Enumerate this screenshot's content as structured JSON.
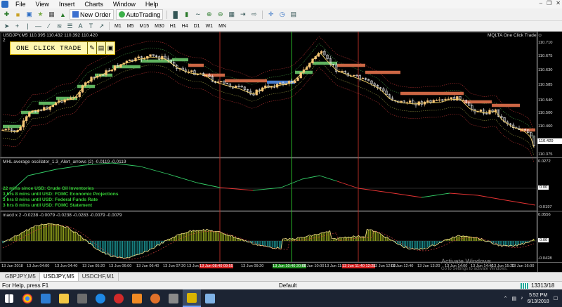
{
  "menu": [
    "File",
    "View",
    "Insert",
    "Charts",
    "Window",
    "Help"
  ],
  "toolbar": {
    "new_order": "New Order",
    "autotrading": "AutoTrading",
    "timeframes": [
      "M1",
      "M5",
      "M15",
      "M30",
      "H1",
      "H4",
      "D1",
      "W1",
      "MN"
    ]
  },
  "chart": {
    "symbol_line": "USDJPY,M5  110.395 110.432 110.392 110.420",
    "sub_line": "2",
    "panel_title": "MQLTA One Click Trade",
    "oct_label": "ONE CLICK TRADE",
    "oct_buttons": [
      "pencil-icon",
      "book-icon",
      "document-icon"
    ],
    "price_ticks": [
      "110.710",
      "110.675",
      "110.630",
      "110.585",
      "110.540",
      "110.500",
      "110.460",
      "110.375"
    ],
    "current_price": "110.420",
    "osc_title": "MHL average oscillator_1.3_Alert_arrows (2) -0.0119 -0.0119",
    "osc_ticks": [
      "0.0272",
      "0.00",
      "-0.0197"
    ],
    "macd_title": "macd x 2 -0.0238 -0.0079 -0.0238 -0.0283 -0.0079 -0.0079",
    "macd_ticks": [
      "0.0556",
      "0.00",
      "-0.0428"
    ],
    "news": [
      "22 mins since USD: Crude Oil Inventories",
      "3 hrs 8 mins until USD: FOMC Economic Projections",
      "3 hrs 8 mins until USD: Federal Funds Rate",
      "3 hrs 8 mins until USD: FOMC Statement"
    ],
    "time_labels": [
      "13 Jun 2018",
      "13 Jun 04:00",
      "13 Jun 04:40",
      "13 Jun 05:20",
      "13 Jun 06:00",
      "13 Jun 06:40",
      "13 Jun 07:20",
      "13 Jun 08:00",
      "13 Jun 09:20",
      "13 Jun 10:00",
      "13 Jun 11:20",
      "13 Jun 12:00",
      "13 Jun 12:40",
      "13 Jun 13:20",
      "13 Jun 14:00",
      "13 Jun 14:40",
      "13 Jun 15:20",
      "13 Jun 16:00",
      "13 Jun 16:40"
    ],
    "marker_labels": [
      {
        "text": "13 Jun 08:40 09:55",
        "color": "#d21f1f"
      },
      {
        "text": "13 Jun 10:40 20:46",
        "color": "#1c8d1c"
      },
      {
        "text": "13 Jun 11:40 12:25",
        "color": "#d21f1f"
      }
    ],
    "watermark": "Activate Windows",
    "watermark_sub": "Go to Settings to activate Windows."
  },
  "tabs": [
    "GBPJPY,M5",
    "USDJPY,M5",
    "USDCHF,M1"
  ],
  "active_tab": "USDJPY,M5",
  "status": {
    "help": "For Help, press F1",
    "profile": "Default",
    "traffic": "13313/18 kb"
  },
  "taskbar": {
    "time": "5:52 PM",
    "date": "6/13/2018",
    "apps": [
      "windows-start-icon",
      "chrome-icon",
      "photos-icon",
      "explorer-icon",
      "store-icon",
      "ie-icon",
      "opera-icon",
      "vlc-icon",
      "search-app-icon",
      "calculator-icon",
      "metatrader-icon",
      "notepad-icon"
    ]
  },
  "colors": {
    "chart_bg": "#000000",
    "bull": "#f5c27a",
    "bear": "#ffffff",
    "band_up": "#5fb35f",
    "band_down": "#cc6644",
    "osc_up": "#33cc66",
    "osc_down": "#e53333",
    "macd_hist": "#8a9a1a",
    "macd_hist_neg": "#1a8a8a"
  }
}
